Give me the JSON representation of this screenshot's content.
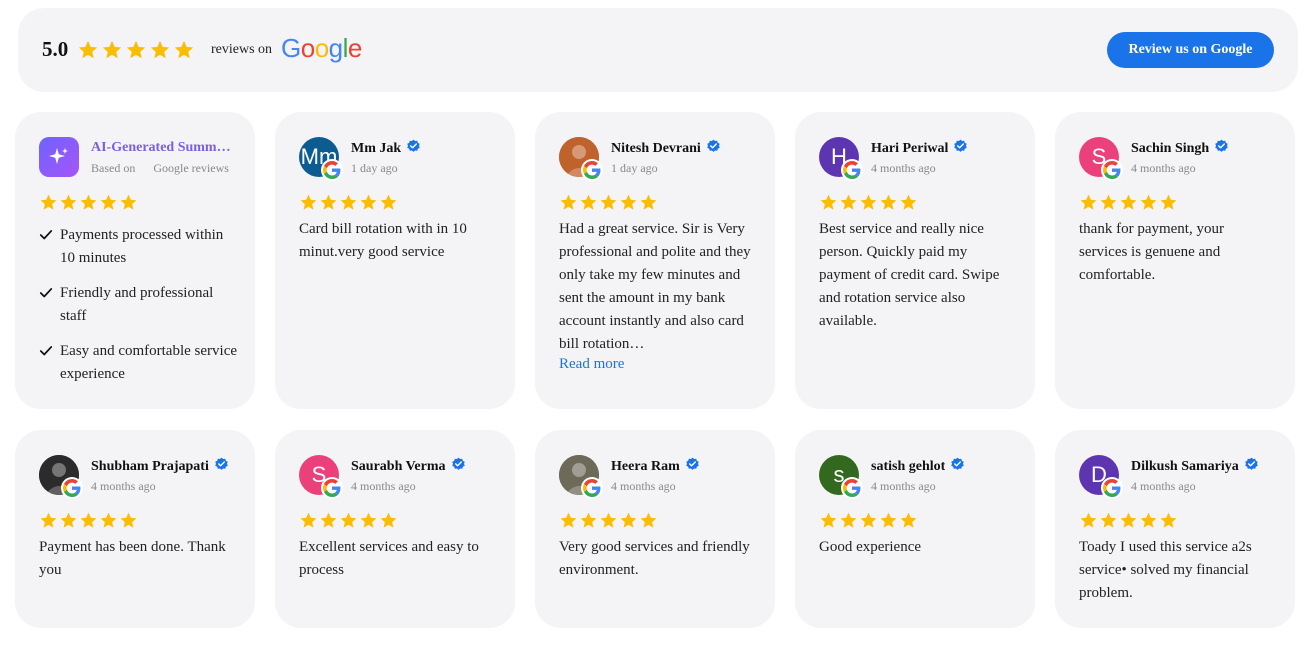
{
  "header": {
    "rating": "5.0",
    "star_count": 5,
    "reviews_on": "reviews on",
    "google_logo": "Google",
    "button_label": "Review us on Google"
  },
  "colors": {
    "star": "#fbbc04",
    "accent": "#1a73e8",
    "verified": "#1a73e8",
    "ai_title": "#7b5fe0"
  },
  "summary": {
    "title": "AI-Generated Summary",
    "based_on": "Based on",
    "source": "Google reviews",
    "stars": 5,
    "points": [
      "Payments processed within 10 minutes",
      "Friendly and professional staff",
      "Easy and comfortable service experience"
    ]
  },
  "reviews": [
    {
      "name": "Mm Jak",
      "initial": "Mm",
      "avatar_color": "#0d5c91",
      "photo": false,
      "date": "1 day ago",
      "stars": 5,
      "text": "Card bill rotation with in 10 minut.very good service"
    },
    {
      "name": "Nitesh Devrani",
      "initial": "",
      "avatar_color": "#c0622b",
      "photo": true,
      "date": "1 day ago",
      "stars": 5,
      "text": "Had a great service. Sir is Very professional and polite and they only take my few minutes and sent the amount in my bank account instantly and also card bill rotation…",
      "read_more": "Read more"
    },
    {
      "name": "Hari Periwal",
      "initial": "H",
      "avatar_color": "#5e35b1",
      "photo": false,
      "date": "4 months ago",
      "stars": 5,
      "text": "Best service and really nice person. Quickly paid my payment of credit card. Swipe and rotation service also available."
    },
    {
      "name": "Sachin Singh",
      "initial": "S",
      "avatar_color": "#ec407a",
      "photo": false,
      "date": "4 months ago",
      "stars": 5,
      "text": "thank for payment, your services is genuene and comfortable."
    },
    {
      "name": "Shubham Prajapati",
      "initial": "",
      "avatar_color": "#2b2b2b",
      "photo": true,
      "date": "4 months ago",
      "stars": 5,
      "text": "Payment has been done. Thank you"
    },
    {
      "name": "Saurabh Verma",
      "initial": "S",
      "avatar_color": "#ec407a",
      "photo": false,
      "date": "4 months ago",
      "stars": 5,
      "text": "Excellent services and easy to process"
    },
    {
      "name": "Heera Ram",
      "initial": "",
      "avatar_color": "#6d6a5a",
      "photo": true,
      "date": "4 months ago",
      "stars": 5,
      "text": "Very good services and friendly environment."
    },
    {
      "name": "satish gehlot",
      "initial": "s",
      "avatar_color": "#33691e",
      "photo": false,
      "date": "4 months ago",
      "stars": 5,
      "text": "Good experience"
    },
    {
      "name": "Dilkush Samariya",
      "initial": "D",
      "avatar_color": "#5e35b1",
      "photo": false,
      "date": "4 months ago",
      "stars": 5,
      "text": "Toady I used this service a2s service• solved my financial problem."
    }
  ],
  "icons": {
    "star": "star-icon",
    "verified": "verified-badge-icon",
    "google_badge": "google-g-icon",
    "check": "check-icon",
    "sparkle": "sparkle-icon"
  }
}
